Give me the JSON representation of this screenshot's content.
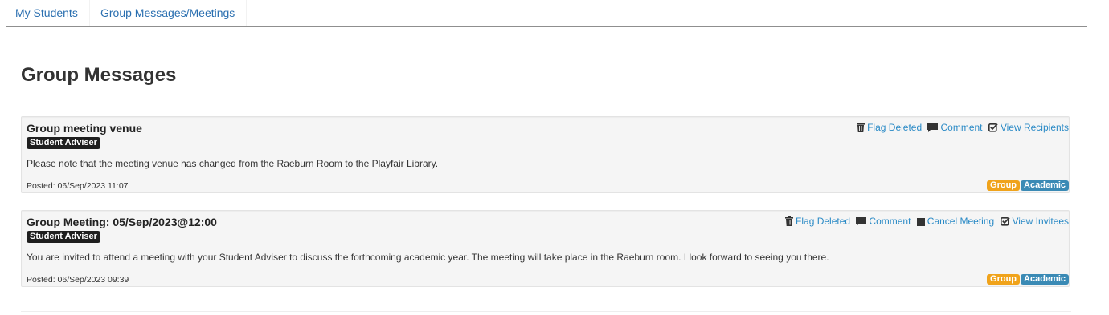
{
  "nav": {
    "tabs": [
      {
        "label": "My Students"
      },
      {
        "label": "Group Messages/Meetings"
      }
    ]
  },
  "page": {
    "title": "Group Messages"
  },
  "messages": [
    {
      "title": "Group meeting venue",
      "role": "Student Adviser",
      "body": "Please note that the meeting venue has changed from the Raeburn Room to the Playfair Library.",
      "posted": "Posted: 06/Sep/2023 11:07",
      "actions": {
        "flag": "Flag Deleted",
        "comment": "Comment",
        "view": "View Recipients"
      },
      "tags": {
        "group": "Group",
        "academic": "Academic"
      }
    },
    {
      "title": "Group Meeting: 05/Sep/2023@12:00",
      "role": "Student Adviser",
      "body": "You are invited to attend a meeting with your Student Adviser to discuss the forthcoming academic year. The meeting will take place in the Raeburn room. I look forward to seeing you there.",
      "posted": "Posted: 06/Sep/2023 09:39",
      "actions": {
        "flag": "Flag Deleted",
        "comment": "Comment",
        "cancel": "Cancel Meeting",
        "view": "View Invitees"
      },
      "tags": {
        "group": "Group",
        "academic": "Academic"
      }
    }
  ],
  "colors": {
    "link": "#2a8ac6",
    "tab_link": "#2a6fb0",
    "tag_group": "#f0a31b",
    "tag_academic": "#3a8ab5",
    "role_badge": "#1f1f1f"
  }
}
